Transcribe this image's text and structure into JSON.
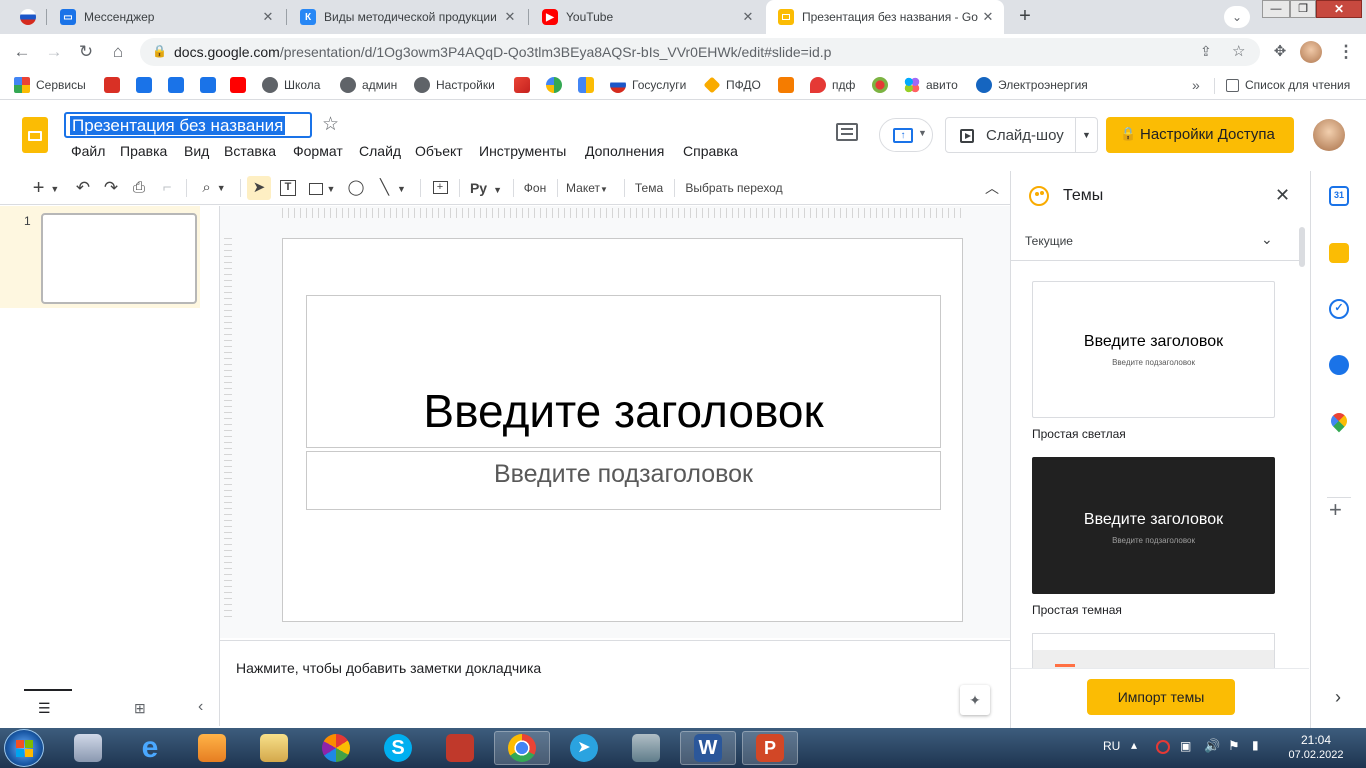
{
  "browser": {
    "tabs": [
      {
        "title": "",
        "icon": "russia-flag-icon",
        "active": false
      },
      {
        "title": "Мессенджер",
        "icon": "messenger-icon",
        "active": false
      },
      {
        "title": "Виды методической продукции",
        "icon": "vk-icon",
        "active": false
      },
      {
        "title": "YouTube",
        "icon": "youtube-icon",
        "active": false
      },
      {
        "title": "Презентация без названия - Go",
        "icon": "slides-icon",
        "active": true
      }
    ],
    "url_host": "docs.google.com",
    "url_path": "/presentation/d/1Og3owm3P4AQqD-Qo3tlm3BEya8AQSr-bIs_VVr0EHWk/edit#slide=id.p"
  },
  "bookmarks": {
    "items": [
      "Сервисы",
      "",
      "",
      "",
      "",
      "Школа",
      "админ",
      "Настройки",
      "",
      "",
      "",
      "Госуслуги",
      "ПФДО",
      "",
      "пдф",
      "",
      "авито",
      "Электроэнергия"
    ],
    "reading_list": "Список для чтения"
  },
  "app": {
    "doc_title": "Презентация без названия",
    "menus": [
      "Файл",
      "Правка",
      "Вид",
      "Вставка",
      "Формат",
      "Слайд",
      "Объект",
      "Инструменты",
      "Дополнения",
      "Справка"
    ],
    "slideshow_label": "Слайд-шоу",
    "share_label": "Настройки Доступа",
    "accent": "#fbbc04"
  },
  "toolbar": {
    "background_label": "Фон",
    "layout_label": "Макет",
    "theme_label": "Тема",
    "transition_label": "Выбрать переход"
  },
  "filmstrip": {
    "slide_number": "1"
  },
  "slide": {
    "title_placeholder": "Введите заголовок",
    "subtitle_placeholder": "Введите подзаголовок"
  },
  "notes": {
    "placeholder": "Нажмите, чтобы добавить заметки докладчика"
  },
  "themes_panel": {
    "heading": "Темы",
    "current_label": "Текущие",
    "themes": [
      {
        "name": "Простая светлая",
        "title": "Введите заголовок",
        "subtitle": "Введите подзаголовок"
      },
      {
        "name": "Простая темная",
        "title": "Введите заголовок",
        "subtitle": "Введите подзаголовок"
      }
    ],
    "import_label": "Импорт темы"
  },
  "taskbar": {
    "lang": "RU",
    "time": "21:04",
    "date": "07.02.2022"
  }
}
